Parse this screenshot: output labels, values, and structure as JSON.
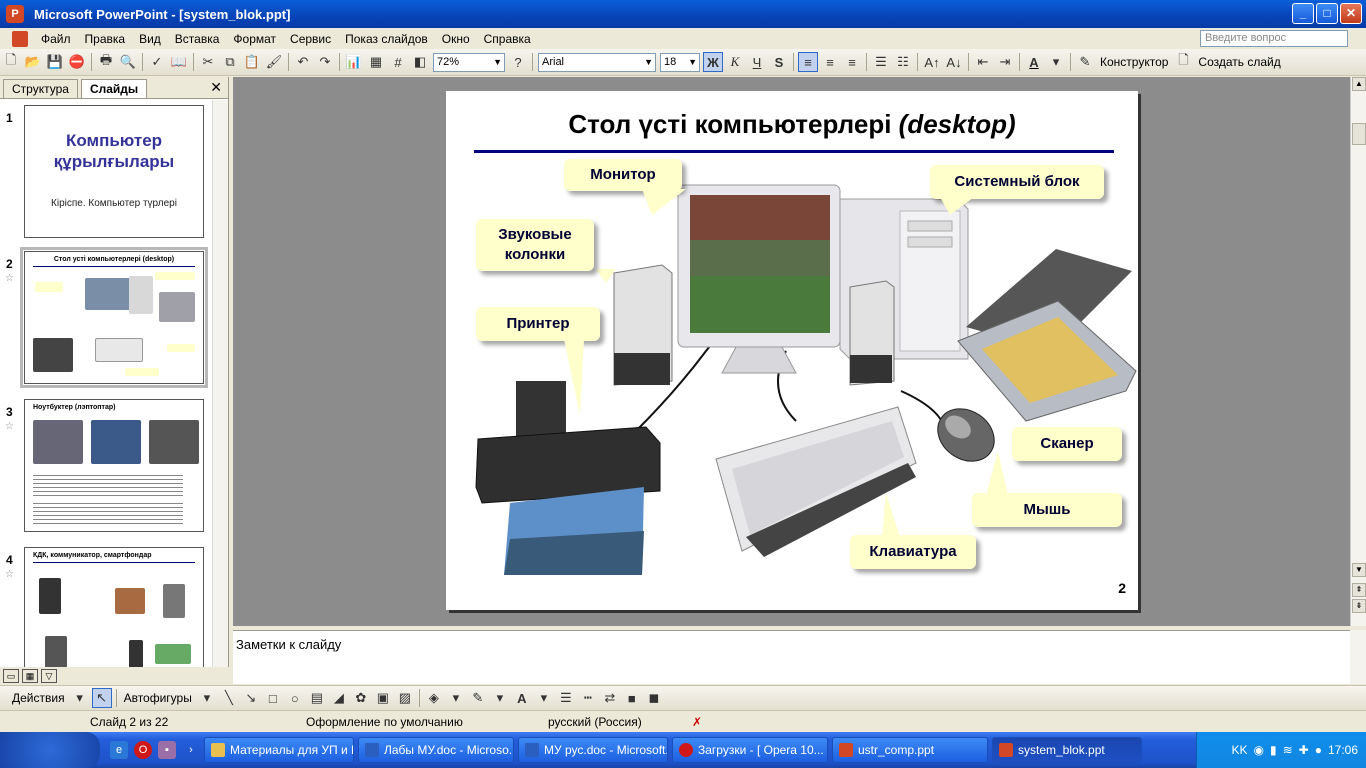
{
  "window": {
    "title": "Microsoft PowerPoint - [system_blok.ppt]"
  },
  "menu": {
    "items": [
      "Файл",
      "Правка",
      "Вид",
      "Вставка",
      "Формат",
      "Сервис",
      "Показ слайдов",
      "Окно",
      "Справка"
    ],
    "help_placeholder": "Введите вопрос"
  },
  "toolbar": {
    "zoom": "72%",
    "font_name": "Arial",
    "font_size": "18",
    "bold": "Ж",
    "italic": "К",
    "underline": "Ч",
    "shadow": "S",
    "designer_label": "Конструктор",
    "new_slide_label": "Создать слайд"
  },
  "left_panel": {
    "tabs": [
      "Структура",
      "Слайды"
    ],
    "active_tab": "Слайды",
    "slides": [
      {
        "num": "1",
        "title": "Компьютер құрылғылары",
        "subtitle": "Кіріспе. Компьютер түрлері"
      },
      {
        "num": "2",
        "title": "Стол усті компьютерлері (desktop)"
      },
      {
        "num": "3",
        "title": "Ноутбуктер (лэптоптар)"
      },
      {
        "num": "4",
        "title": "КДК, коммуникатор, смартфондар"
      }
    ]
  },
  "slide": {
    "title_main": "Стол үсті компьютерлері",
    "title_italic": "(desktop)",
    "number": "2",
    "callouts": {
      "monitor": "Монитор",
      "system_unit": "Системный блок",
      "speakers": "Звуковые колонки",
      "printer": "Принтер",
      "scanner": "Сканер",
      "mouse": "Мышь",
      "keyboard": "Клавиатура"
    }
  },
  "notes": {
    "placeholder": "Заметки к слайду"
  },
  "drawing": {
    "actions_label": "Действия",
    "autoshapes_label": "Автофигуры"
  },
  "status": {
    "slide_position": "Слайд 2 из 22",
    "design": "Оформление по умолчанию",
    "language": "русский (Россия)"
  },
  "taskbar": {
    "tasks": [
      "Материалы для УП и МУ",
      "Лабы МУ.doc - Microso...",
      "МУ рус.doc - Microsoft...",
      "Загрузки - [ Opera 10...",
      "ustr_comp.ppt",
      "system_blok.ppt"
    ],
    "language": "KK",
    "clock": "17:06"
  },
  "colors": {
    "accent": "#0a5fd8",
    "callout_fill": "#ffffcc",
    "title_rule": "#000080",
    "thumb_title": "#333399"
  }
}
